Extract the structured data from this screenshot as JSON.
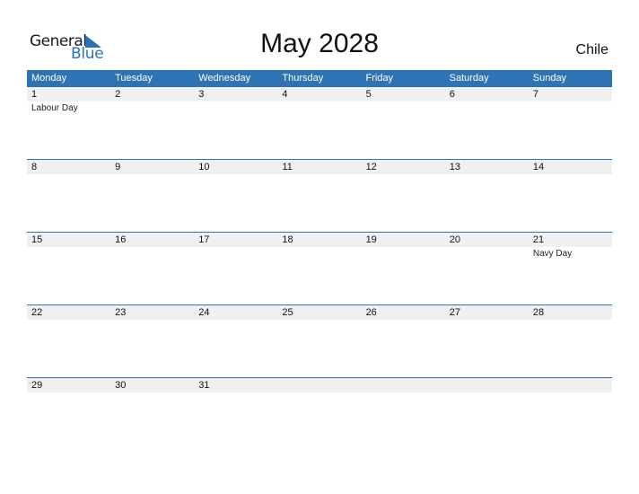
{
  "logo": {
    "line1": "General",
    "line2": "Blue"
  },
  "title": "May 2028",
  "country": "Chile",
  "colors": {
    "accent": "#2e74b5",
    "strip": "#f0f0f0"
  },
  "weekdays": [
    "Monday",
    "Tuesday",
    "Wednesday",
    "Thursday",
    "Friday",
    "Saturday",
    "Sunday"
  ],
  "weeks": [
    {
      "days": [
        {
          "num": "1",
          "event": "Labour Day"
        },
        {
          "num": "2",
          "event": ""
        },
        {
          "num": "3",
          "event": ""
        },
        {
          "num": "4",
          "event": ""
        },
        {
          "num": "5",
          "event": ""
        },
        {
          "num": "6",
          "event": ""
        },
        {
          "num": "7",
          "event": ""
        }
      ]
    },
    {
      "days": [
        {
          "num": "8",
          "event": ""
        },
        {
          "num": "9",
          "event": ""
        },
        {
          "num": "10",
          "event": ""
        },
        {
          "num": "11",
          "event": ""
        },
        {
          "num": "12",
          "event": ""
        },
        {
          "num": "13",
          "event": ""
        },
        {
          "num": "14",
          "event": ""
        }
      ]
    },
    {
      "days": [
        {
          "num": "15",
          "event": ""
        },
        {
          "num": "16",
          "event": ""
        },
        {
          "num": "17",
          "event": ""
        },
        {
          "num": "18",
          "event": ""
        },
        {
          "num": "19",
          "event": ""
        },
        {
          "num": "20",
          "event": ""
        },
        {
          "num": "21",
          "event": "Navy Day"
        }
      ]
    },
    {
      "days": [
        {
          "num": "22",
          "event": ""
        },
        {
          "num": "23",
          "event": ""
        },
        {
          "num": "24",
          "event": ""
        },
        {
          "num": "25",
          "event": ""
        },
        {
          "num": "26",
          "event": ""
        },
        {
          "num": "27",
          "event": ""
        },
        {
          "num": "28",
          "event": ""
        }
      ]
    },
    {
      "days": [
        {
          "num": "29",
          "event": ""
        },
        {
          "num": "30",
          "event": ""
        },
        {
          "num": "31",
          "event": ""
        },
        {
          "num": "",
          "event": ""
        },
        {
          "num": "",
          "event": ""
        },
        {
          "num": "",
          "event": ""
        },
        {
          "num": "",
          "event": ""
        }
      ]
    }
  ]
}
